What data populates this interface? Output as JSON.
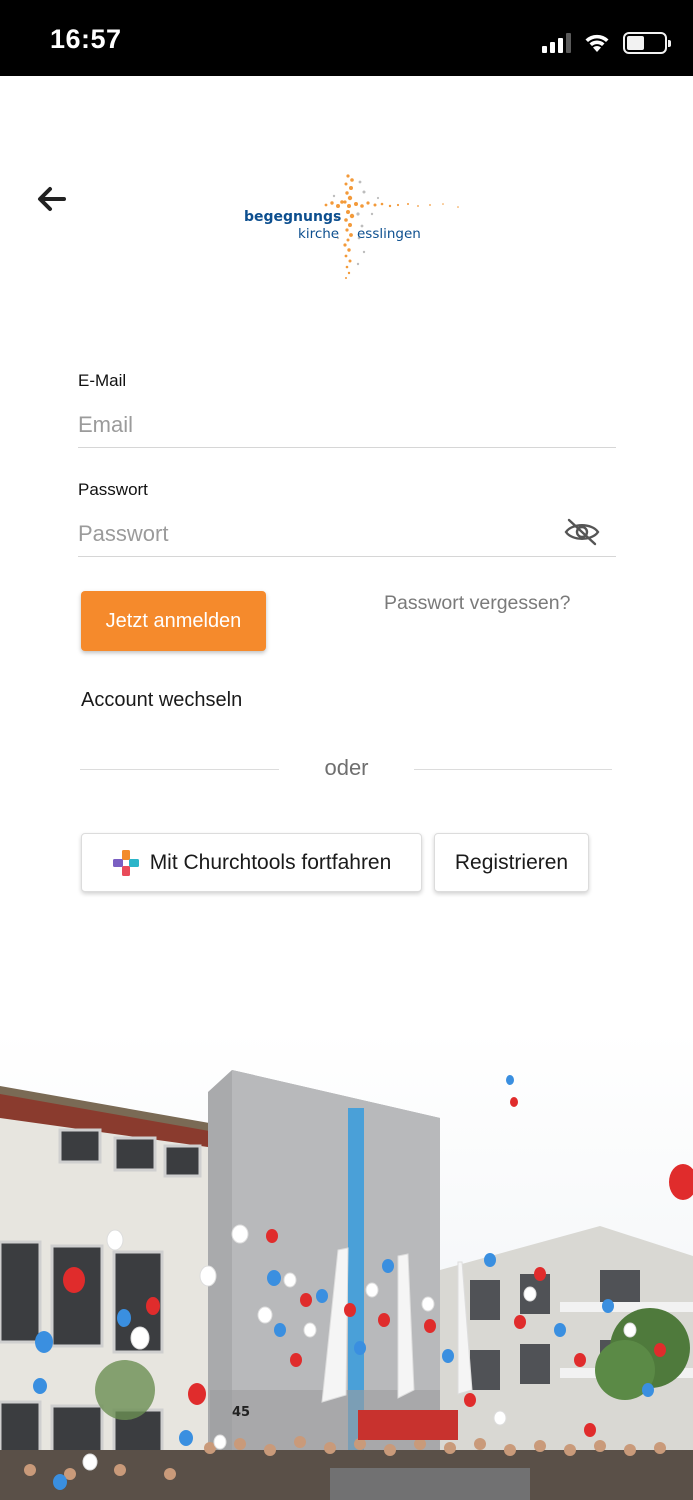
{
  "status_bar": {
    "time": "16:57",
    "icons": [
      "signal-icon",
      "wifi-icon",
      "battery-icon"
    ]
  },
  "header": {
    "back_icon": "arrow-left-icon",
    "logo": {
      "word_1": "begegnungs",
      "word_2": "kirche",
      "word_3": "esslingen",
      "colors": {
        "text": "#0d4f8f",
        "cross": "#f39a3a"
      }
    }
  },
  "form": {
    "email": {
      "label": "E-Mail",
      "placeholder": "Email",
      "value": ""
    },
    "password": {
      "label": "Passwort",
      "placeholder": "Passwort",
      "value": "",
      "toggle_icon": "eye-slash-icon"
    },
    "login_label": "Jetzt anmelden",
    "forgot_label": "Passwort vergessen?",
    "switch_account_label": "Account wechseln"
  },
  "divider": {
    "label": "oder"
  },
  "alternatives": {
    "churchtools_label": "Mit Churchtools fortfahren",
    "churchtools_icon": "churchtools-logo-icon",
    "register_label": "Registrieren"
  },
  "hero": {
    "description_icon": "church-building-balloons-photo",
    "building_number": "45"
  },
  "colors": {
    "accent": "#f58a2c",
    "status_bar_bg": "#000000",
    "placeholder": "#9b9b9b"
  }
}
